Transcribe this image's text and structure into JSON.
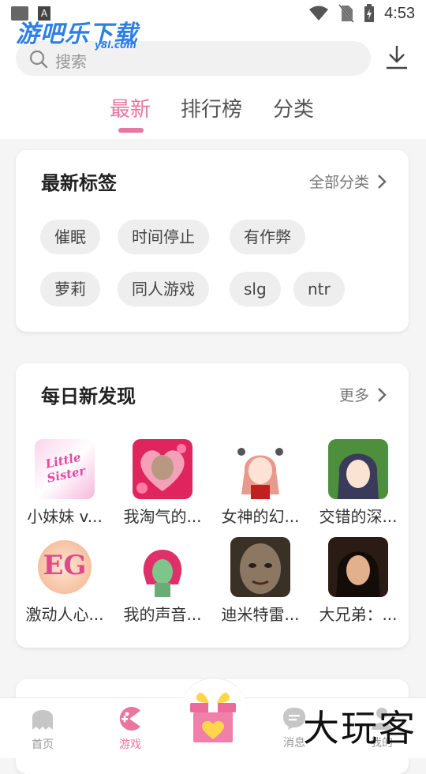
{
  "status_bar": {
    "time": "4:53",
    "left_icon_letter": "A"
  },
  "logo": {
    "name": "游吧乐下载",
    "sub": "y8l.com"
  },
  "search": {
    "placeholder": "搜索"
  },
  "tabs": [
    {
      "label": "最新",
      "active": true
    },
    {
      "label": "排行榜",
      "active": false
    },
    {
      "label": "分类",
      "active": false
    }
  ],
  "tags_card": {
    "title": "最新标签",
    "more_label": "全部分类",
    "tags": [
      "催眠",
      "时间停止",
      "有作弊",
      "萝莉",
      "同人游戏",
      "slg",
      "ntr"
    ]
  },
  "daily_card": {
    "title": "每日新发现",
    "more_label": "更多",
    "games": [
      {
        "title": "小妹妹 v...",
        "thumb_text": "Little Sister"
      },
      {
        "title": "我淘气的..."
      },
      {
        "title": "女神的幻..."
      },
      {
        "title": "交错的深..."
      },
      {
        "title": "激动人心...",
        "thumb_text": "EG"
      },
      {
        "title": "我的声音..."
      },
      {
        "title": "迪米特雷..."
      },
      {
        "title": "大兄弟：..."
      }
    ]
  },
  "bottom_nav": [
    {
      "label": "首页",
      "icon": "ghost-icon"
    },
    {
      "label": "游戏",
      "icon": "pacman-icon",
      "active": true
    },
    {
      "label": "",
      "icon": "gift-icon"
    },
    {
      "label": "消息",
      "icon": "message-icon"
    },
    {
      "label": "我的",
      "icon": "profile-icon"
    }
  ],
  "watermark": "大玩客",
  "colors": {
    "accent": "#e8769f",
    "logo_blue": "#2d7fe8"
  }
}
